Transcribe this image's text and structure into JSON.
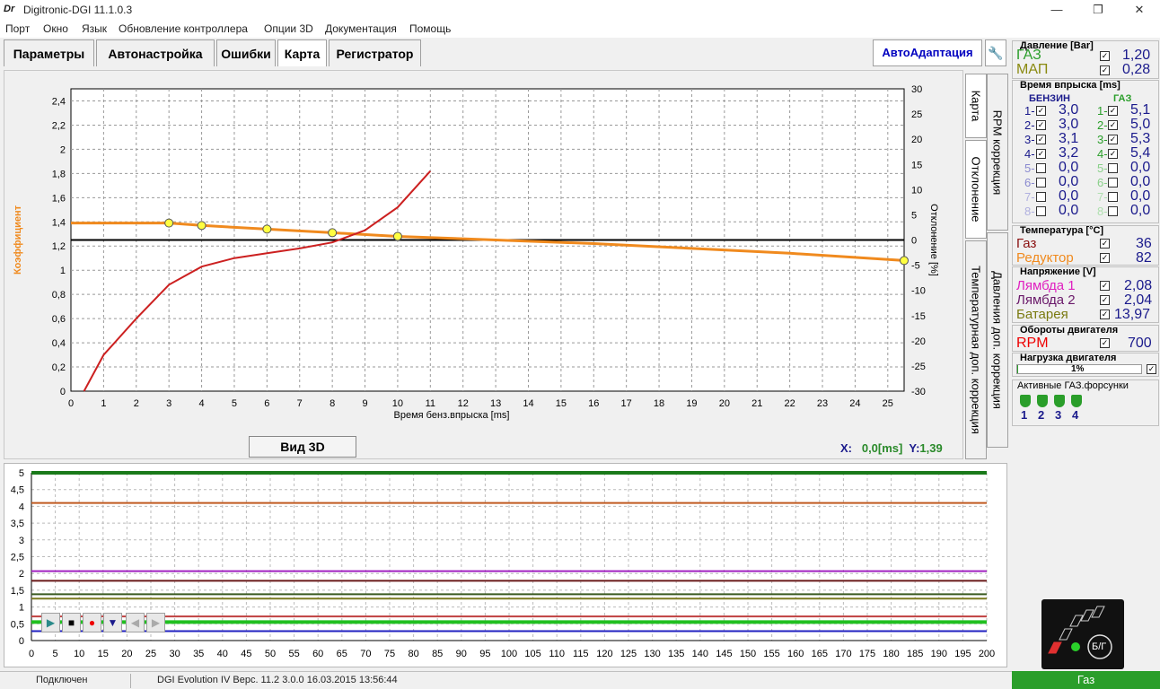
{
  "window": {
    "logo": "Dr",
    "title": "Digitronic-DGI  11.1.0.3",
    "minimize": "—",
    "maximize": "❐",
    "close": "✕"
  },
  "menu": [
    "Порт",
    "Окно",
    "Язык",
    "Обновление контроллера",
    "Опции 3D",
    "Документация",
    "Помощь"
  ],
  "tabs": [
    "Параметры",
    "Автонастройка",
    "Ошибки",
    "Карта",
    "Регистратор"
  ],
  "active_tab": "Карта",
  "autoadapt_label": "АвтоАдаптация",
  "side_tabs": [
    "Карта",
    "RPM коррекция",
    "Отклонение",
    "Давления доп. коррекция",
    "Температурная доп. коррекция"
  ],
  "btn_3d": "Вид 3D",
  "xy_readout": {
    "x_label": "X:",
    "x_value": "0,0[ms]",
    "y_label": "Y:",
    "y_value": "1,39"
  },
  "pressure": {
    "title": "Давление [Bar]",
    "gas_label": "ГАЗ",
    "gas_value": "1,20",
    "map_label": "МАП",
    "map_value": "0,28"
  },
  "injection": {
    "title": "Время впрыска [ms]",
    "benzin_label": "БЕНЗИН",
    "gas_label": "ГАЗ",
    "benzin": [
      {
        "n": "1-",
        "v": "3,0",
        "checked": true
      },
      {
        "n": "2-",
        "v": "3,0",
        "checked": true
      },
      {
        "n": "3-",
        "v": "3,1",
        "checked": true
      },
      {
        "n": "4-",
        "v": "3,2",
        "checked": true
      },
      {
        "n": "5-",
        "v": "0,0",
        "checked": false
      },
      {
        "n": "6-",
        "v": "0,0",
        "checked": false
      },
      {
        "n": "7-",
        "v": "0,0",
        "checked": false
      },
      {
        "n": "8-",
        "v": "0,0",
        "checked": false
      }
    ],
    "gas": [
      {
        "n": "1-",
        "v": "5,1",
        "checked": true
      },
      {
        "n": "2-",
        "v": "5,0",
        "checked": true
      },
      {
        "n": "3-",
        "v": "5,3",
        "checked": true
      },
      {
        "n": "4-",
        "v": "5,4",
        "checked": true
      },
      {
        "n": "5-",
        "v": "0,0",
        "checked": false
      },
      {
        "n": "6-",
        "v": "0,0",
        "checked": false
      },
      {
        "n": "7-",
        "v": "0,0",
        "checked": false
      },
      {
        "n": "8-",
        "v": "0,0",
        "checked": false
      }
    ]
  },
  "temperature": {
    "title": "Температура [°C]",
    "gas_label": "Газ",
    "gas_value": "36",
    "reducer_label": "Редуктор",
    "reducer_value": "82"
  },
  "voltage": {
    "title": "Напряжение [V]",
    "lambda1_label": "Лямбда 1",
    "lambda1_value": "2,08",
    "lambda2_label": "Лямбда 2",
    "lambda2_value": "2,04",
    "battery_label": "Батарея",
    "battery_value": "13,97"
  },
  "rpm": {
    "title": "Обороты двигателя",
    "label": "RPM",
    "value": "700"
  },
  "load": {
    "title": "Нагрузка двигателя",
    "value": "1%",
    "level": 0.01
  },
  "active_injectors": {
    "title": "Активные ГАЗ.форсунки",
    "items": [
      "1",
      "2",
      "3",
      "4"
    ]
  },
  "indicator": {
    "label": "Б/Г"
  },
  "status": {
    "connection": "Подключен",
    "device": "DGI Evolution IV   Верс. 11.2  3.0.0    16.03.2015 13:56:44",
    "mode": "Газ"
  },
  "colors": {
    "orange": "#f08a1e",
    "red": "#cc2020",
    "gas_green": "#2a9e2a",
    "blue_value": "#1a1a8c"
  },
  "chart_data": [
    {
      "type": "line",
      "title": "",
      "xlabel": "Время бенз.впрыска [ms]",
      "ylabel": "Коэффициент",
      "y2label": "Отклонение [%]",
      "xlim": [
        0,
        25.5
      ],
      "ylim": [
        0,
        2.5
      ],
      "y2lim": [
        -30,
        30
      ],
      "x_ticks": [
        "0",
        "1",
        "2",
        "3",
        "4",
        "5",
        "6",
        "7",
        "8",
        "9",
        "10",
        "11",
        "12",
        "13",
        "14",
        "15",
        "16",
        "17",
        "18",
        "19",
        "20",
        "21",
        "22",
        "23",
        "24",
        "25"
      ],
      "y_ticks": [
        "0",
        "0,2",
        "0,4",
        "0,6",
        "0,8",
        "1",
        "1,2",
        "1,4",
        "1,6",
        "1,8",
        "2",
        "2,2",
        "2,4"
      ],
      "y2_ticks": [
        "30",
        "25",
        "20",
        "15",
        "10",
        "5",
        "0",
        "-5",
        "-10",
        "-15",
        "-20",
        "-25",
        "-30"
      ],
      "grid": true,
      "series": [
        {
          "color": "#f08a1e",
          "points": [
            [
              0,
              1.39
            ],
            [
              3,
              1.39
            ],
            [
              4,
              1.37
            ],
            [
              6,
              1.34
            ],
            [
              8,
              1.31
            ],
            [
              10,
              1.28
            ],
            [
              13,
              1.25
            ],
            [
              16,
              1.22
            ],
            [
              19,
              1.18
            ],
            [
              22,
              1.14
            ],
            [
              25.5,
              1.08
            ]
          ]
        },
        {
          "color": "#cc2020",
          "points": [
            [
              0.4,
              0
            ],
            [
              1,
              0.3
            ],
            [
              2,
              0.6
            ],
            [
              3,
              0.88
            ],
            [
              4,
              1.03
            ],
            [
              5,
              1.1
            ],
            [
              6,
              1.14
            ],
            [
              7,
              1.18
            ],
            [
              8,
              1.23
            ],
            [
              9,
              1.33
            ],
            [
              10,
              1.52
            ],
            [
              11,
              1.82
            ]
          ]
        }
      ],
      "markers": [
        [
          3,
          1.39
        ],
        [
          4,
          1.37
        ],
        [
          6,
          1.34
        ],
        [
          8,
          1.31
        ],
        [
          10,
          1.28
        ],
        [
          25.5,
          1.08
        ]
      ],
      "reference_y2": 0
    },
    {
      "type": "line",
      "title": "",
      "xlim": [
        0,
        200
      ],
      "ylim": [
        0,
        5
      ],
      "x_ticks": [
        "0",
        "5",
        "10",
        "15",
        "20",
        "25",
        "30",
        "35",
        "40",
        "45",
        "50",
        "55",
        "60",
        "65",
        "70",
        "75",
        "80",
        "85",
        "90",
        "95",
        "100",
        "105",
        "110",
        "115",
        "120",
        "125",
        "130",
        "135",
        "140",
        "145",
        "150",
        "155",
        "160",
        "165",
        "170",
        "175",
        "180",
        "185",
        "190",
        "195",
        "200"
      ],
      "y_ticks": [
        "0",
        "0,5",
        "1",
        "1,5",
        "2",
        "2,5",
        "3",
        "3,5",
        "4",
        "4,5",
        "5"
      ],
      "grid": true,
      "series": [
        {
          "color": "#1a7a1a",
          "value": 5.0
        },
        {
          "color": "#c05a20",
          "value": 4.1
        },
        {
          "color": "#a020c0",
          "value": 2.07
        },
        {
          "color": "#6a1a1a",
          "value": 1.78
        },
        {
          "color": "#3a5a20",
          "value": 1.38
        },
        {
          "color": "#7a7a20",
          "value": 1.25
        },
        {
          "color": "#c04040",
          "value": 0.72
        },
        {
          "color": "#20c020",
          "value": 0.55
        },
        {
          "color": "#2020c0",
          "value": 0.28
        }
      ]
    }
  ]
}
